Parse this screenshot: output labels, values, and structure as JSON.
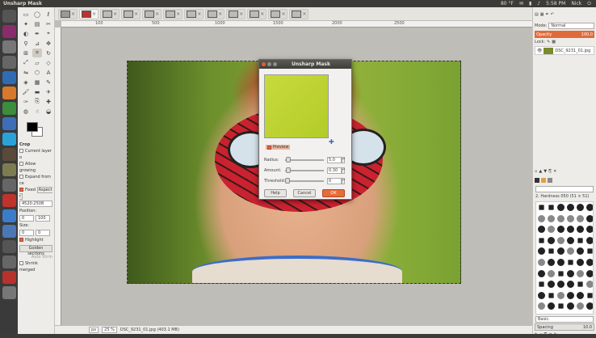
{
  "topbar": {
    "title": "Unsharp Mask",
    "temp": "80 °F",
    "time": "5:58 PM",
    "user": "Nick"
  },
  "image_tabs": [
    {
      "label": "",
      "active": false
    },
    {
      "label": "",
      "active": true
    },
    {
      "label": "",
      "active": false
    },
    {
      "label": "",
      "active": false
    },
    {
      "label": "",
      "active": false
    },
    {
      "label": "",
      "active": false
    },
    {
      "label": "",
      "active": false
    },
    {
      "label": "",
      "active": false
    },
    {
      "label": "",
      "active": false
    },
    {
      "label": "",
      "active": false
    },
    {
      "label": "",
      "active": false
    },
    {
      "label": "",
      "active": false
    }
  ],
  "ruler": {
    "ticks": [
      "100",
      "500",
      "1000",
      "1500",
      "2000",
      "2500"
    ]
  },
  "tool_options": {
    "title": "Crop",
    "current_layer_only": "Current layer o",
    "allow_growing": "Allow growing",
    "expand_from_center": "Expand from ce",
    "fixed": "Fixed",
    "fixed_mode": "Aspect r",
    "ratio": "4520:2508",
    "position_label": "Position:",
    "position_x": "0",
    "position_y": "100",
    "size_label": "Size:",
    "size_x": "0",
    "size_y": "0",
    "highlight": "Highlight",
    "guides": "Golden sections",
    "auto_shrink": "Auto Shrin",
    "shrink_merged": "Shrink merged"
  },
  "statusbar": {
    "unit": "px",
    "zoom": "25 %",
    "file": "DSC_9231_01.jpg (403.1 MB)"
  },
  "layers": {
    "mode_label": "Mode:",
    "mode_value": "Normal",
    "opacity_label": "Opacity",
    "opacity_value": "100.0",
    "lock_label": "Lock:",
    "layer_name": "DSC_9231_01.jpg"
  },
  "brushes": {
    "filter": "",
    "brush_name": "2. Hardness 050 (51 × 51)",
    "preset": "Basic.",
    "spacing_label": "Spacing",
    "spacing_value": "10.0"
  },
  "dialog": {
    "title": "Unsharp Mask",
    "preview_label": "Preview",
    "radius_label": "Radius:",
    "radius_value": "5.0",
    "radius_fraction": 0.02,
    "amount_label": "Amount:",
    "amount_value": "0.30",
    "amount_fraction": 0.03,
    "threshold_label": "Threshold:",
    "threshold_value": "0",
    "threshold_fraction": 0.0,
    "help": "Help",
    "cancel": "Cancel",
    "ok": "OK"
  },
  "colors": {
    "accent": "#e06b3a",
    "fg": "#000000",
    "bg": "#ffffff"
  }
}
